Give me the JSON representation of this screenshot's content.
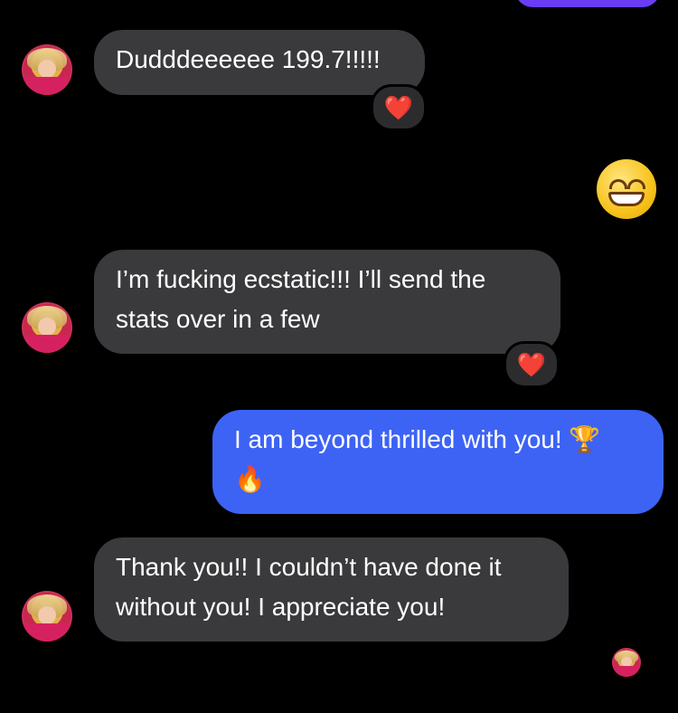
{
  "colors": {
    "background": "#000000",
    "incoming_bubble": "#3a3a3c",
    "outgoing_bubble": "#3d63f5",
    "reaction_heart": "#ff3040",
    "previous_outgoing_bubble": "#6a3df5"
  },
  "messages": [
    {
      "direction": "incoming",
      "lines": [
        "Dudddeeeeee 199.7!!!!!"
      ],
      "reaction": "❤️",
      "avatar_icon": "contact-avatar"
    },
    {
      "direction": "outgoing",
      "emoji_only": "😁",
      "emoji_name": "grinning-face-icon"
    },
    {
      "direction": "incoming",
      "lines": [
        "I’m fucking ecstatic!!! I’ll send the",
        "stats over in a few"
      ],
      "reaction": "❤️",
      "avatar_icon": "contact-avatar"
    },
    {
      "direction": "outgoing",
      "lines": [
        "I am beyond thrilled with you! 🏆",
        "🔥"
      ]
    },
    {
      "direction": "incoming",
      "lines": [
        "Thank you!! I couldn’t have done it",
        "without you! I appreciate you!"
      ],
      "avatar_icon": "contact-avatar"
    }
  ],
  "read_receipt": {
    "icon": "seen-avatar"
  }
}
